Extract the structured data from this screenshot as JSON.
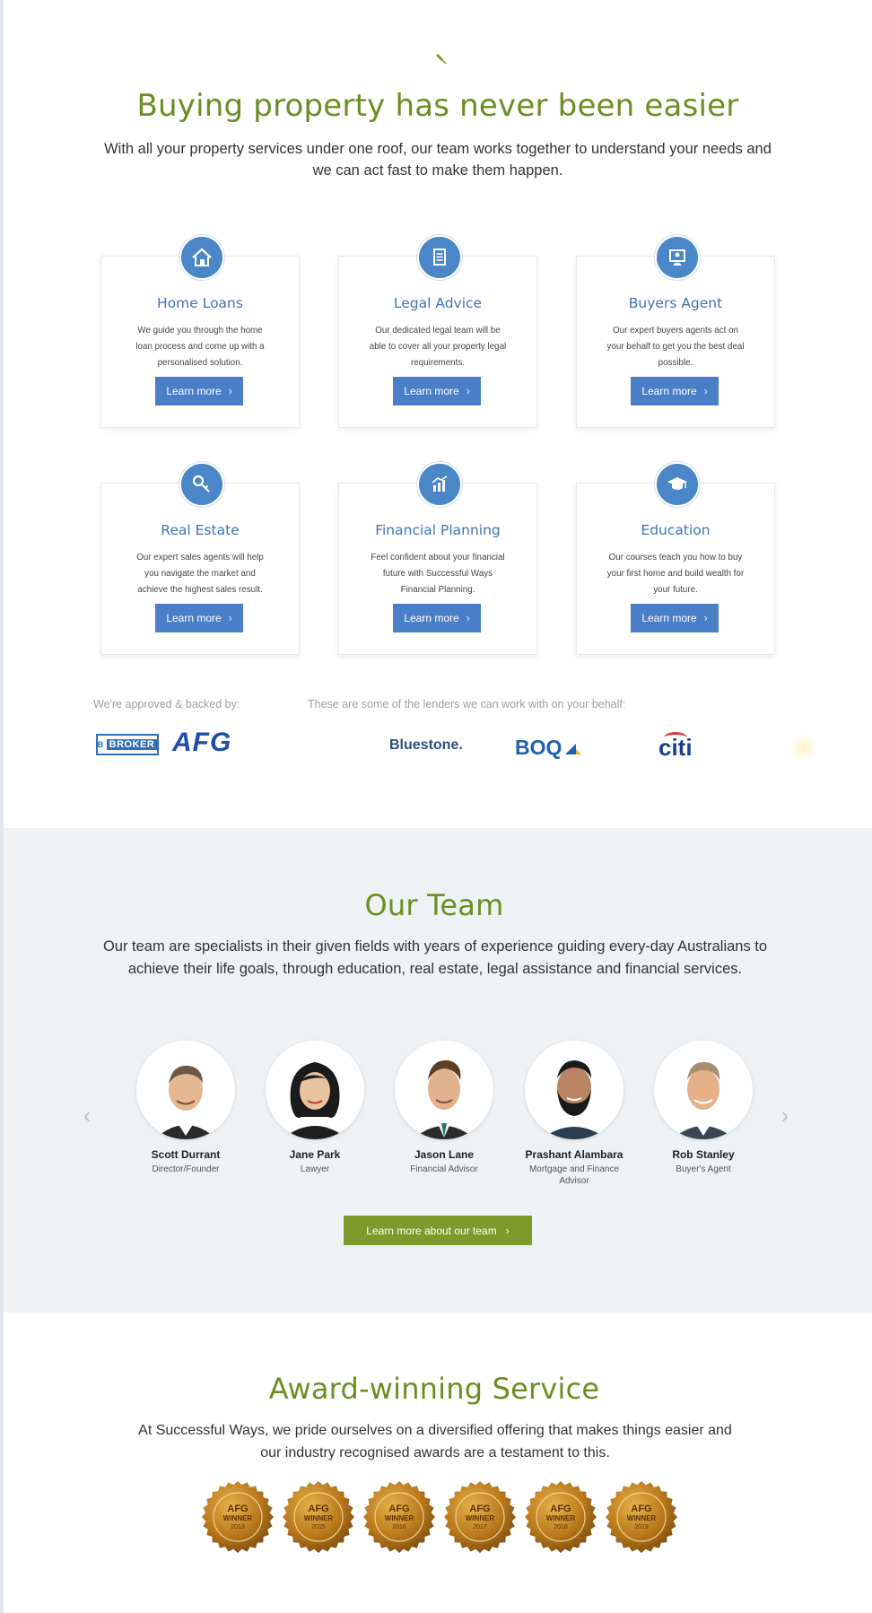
{
  "hero": {
    "title": "Buying property has never been easier",
    "lead": "With all your property services under one roof, our team works together to understand your needs and we can act fast to make them happen."
  },
  "services": [
    {
      "title": "Home Loans",
      "desc": "We guide you through the home loan process and come up with a personalised solution.",
      "button": "Learn more",
      "icon": "house-icon"
    },
    {
      "title": "Legal Advice",
      "desc": "Our dedicated legal team will be able to cover all your property legal requirements.",
      "button": "Learn more",
      "icon": "document-icon"
    },
    {
      "title": "Buyers Agent",
      "desc": "Our expert buyers agents act on your behalf to get you the best deal possible.",
      "button": "Learn more",
      "icon": "agent-icon"
    },
    {
      "title": "Real Estate",
      "desc": "Our expert sales agents will help you navigate the market and achieve the highest sales result.",
      "button": "Learn more",
      "icon": "key-icon"
    },
    {
      "title": "Financial Planning",
      "desc": "Feel confident about your financial future with Successful Ways Financial Planning.",
      "button": "Learn more",
      "icon": "chart-icon"
    },
    {
      "title": "Education",
      "desc": "Our courses teach you how to buy your first home and build wealth for your future.",
      "button": "Learn more",
      "icon": "graduation-cap-icon"
    }
  ],
  "partners": {
    "approved_label": "We're approved & backed by:",
    "lenders_label": "These are some of the lenders we can work with on your behalf:",
    "broker_badge": "BROKER",
    "afg": "AFG",
    "bluestone": "Bluestone.",
    "boq": "BOQ",
    "citi": "citi"
  },
  "team": {
    "title": "Our Team",
    "lead": "Our team are specialists in their given fields with years of experience guiding every-day Australians to achieve their life goals, through education, real estate, legal assistance and financial services.",
    "members": [
      {
        "name": "Scott Durrant",
        "role": "Director/Founder"
      },
      {
        "name": "Jane Park",
        "role": "Lawyer"
      },
      {
        "name": "Jason Lane",
        "role": "Financial Advisor"
      },
      {
        "name": "Prashant Alambara",
        "role": "Mortgage and Finance Advisor"
      },
      {
        "name": "Rob Stanley",
        "role": "Buyer's Agent"
      }
    ],
    "button": "Learn more about our team",
    "prev": "‹",
    "next": "›"
  },
  "awards": {
    "title": "Award-winning Service",
    "lead": "At Successful Ways, we pride ourselves on a diversified offering that makes things easier and our industry recognised awards are a testament to this.",
    "medals": [
      {
        "line1": "AFG",
        "line2": "WINNER",
        "year": "2013"
      },
      {
        "line1": "AFG",
        "line2": "WINNER",
        "year": "2015"
      },
      {
        "line1": "AFG",
        "line2": "WINNER",
        "year": "2016"
      },
      {
        "line1": "AFG",
        "line2": "WINNER",
        "year": "2017"
      },
      {
        "line1": "AFG",
        "line2": "WINNER",
        "year": "2018"
      },
      {
        "line1": "AFG",
        "line2": "WINNER",
        "year": "2019"
      }
    ]
  },
  "colors": {
    "heading_green": "#6b8e23",
    "service_blue": "#4a7fc7",
    "team_button_green": "#7d9a2d",
    "team_bg": "#eef2f5"
  }
}
